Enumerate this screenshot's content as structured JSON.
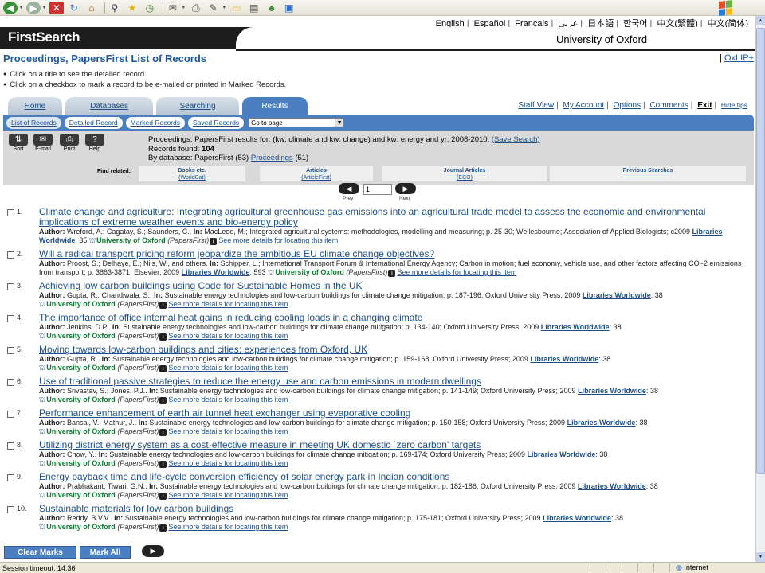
{
  "browser": {
    "toolbar_icons": [
      "back-icon",
      "forward-icon",
      "stop-icon",
      "refresh-icon",
      "home-icon",
      "search-icon",
      "favorites-icon",
      "history-icon",
      "mail-icon",
      "print-icon",
      "edit-icon",
      "folder-icon",
      "research-icon",
      "messenger-icon",
      "screenshot-icon"
    ],
    "status": "Session timeout: 14:36",
    "zone": "Internet"
  },
  "header": {
    "languages": [
      "English",
      "Español",
      "Français",
      "عربي",
      "日本語",
      "한국어",
      "中文(繁體)",
      "中文(简体)"
    ],
    "brand": "FirstSearch",
    "institution": "University of Oxford"
  },
  "page": {
    "title": "Proceedings, PapersFirst List of Records",
    "oxlip": "OxLIP+",
    "instructions": [
      "Click on a title to see the detailed record.",
      "Click on a checkbox to mark a record to be e-mailed or printed in Marked Records."
    ]
  },
  "tabs": [
    "Home",
    "Databases",
    "Searching",
    "Results"
  ],
  "util_links": [
    "Staff View",
    "My Account",
    "Options",
    "Comments",
    "Exit",
    "Hide tips"
  ],
  "subtabs": [
    "List of Records",
    "Detailed Record",
    "Marked Records",
    "Saved Records"
  ],
  "goto": "Go to page",
  "tools": [
    "Sort",
    "E-mail",
    "Print",
    "Help"
  ],
  "summary": {
    "line1": "Proceedings, PapersFirst results for: (kw: climate and kw: change) and kw: energy and yr: 2008-2010.",
    "save": "(Save Search)",
    "found_label": "Records found:",
    "found": "104",
    "bydb_label": "By database:",
    "bydb_papers": "PapersFirst (53)",
    "bydb_proc": "Proceedings",
    "bydb_proc_count": "(51)"
  },
  "find_related": {
    "label": "Find related:",
    "items": [
      {
        "title": "Books etc.",
        "sub": "(WorldCat)"
      },
      {
        "title": "Articles",
        "sub": "(ArticleFirst)"
      },
      {
        "title": "Journal Articles",
        "sub": "(ECO)"
      },
      {
        "title": "Previous Searches",
        "sub": ""
      }
    ]
  },
  "pager": {
    "prev": "Prev",
    "next": "Next",
    "page": "1"
  },
  "records": [
    {
      "num": "1.",
      "title": "Climate change and agriculture: Integrating agricultural greenhouse gas emissions into an agricultural trade model to assess the economic and environmental implications of extreme weather events and bio-energy policy",
      "author": "Wreford, A.; Cagatay, S.; Saunders, C.",
      "in": "MacLeod, M.; Integrated agricultural systems: methodologies, modelling and measuring; p. 25-30; Wellesbourne; Association of Applied Biologists; c2009",
      "lw_count": ": 35",
      "library": "University of Oxford",
      "db": "(PapersFirst)",
      "more": "See more details for locating this item"
    },
    {
      "num": "2.",
      "title": "Will a radical transport pricing reform jeopardize the ambitious EU climate change objectives?",
      "author": "Proost, S.; Delhaye, E.; Nijs, W., and others",
      "in": "Schipper, L.; International Transport Forum & International Energy Agency; Carbon in motion; fuel economy, vehicle use, and other factors affecting CO~2 emissions from transport; p. 3863-3871; Elsevier; 2009",
      "lw_count": ": 593",
      "library": "University of Oxford",
      "db": "(PapersFirst)",
      "more": "See more details for locating this item"
    },
    {
      "num": "3.",
      "title": "Achieving low carbon buildings using Code for Sustainable Homes in the UK",
      "author": "Gupta, R.; Chandiwala, S.",
      "in": "Sustainable energy technologies and low-carbon buildings for climate change mitigation; p. 187-196; Oxford University Press; 2009",
      "lw_count": ": 38",
      "library": "University of Oxford",
      "db": "(PapersFirst)",
      "more": "See more details for locating this item"
    },
    {
      "num": "4.",
      "title": "The importance of office internal heat gains in reducing cooling loads in a changing climate",
      "author": "Jenkins, D.P.",
      "in": "Sustainable energy technologies and low-carbon buildings for climate change mitigation; p. 134-140; Oxford University Press; 2009",
      "lw_count": ": 38",
      "library": "University of Oxford",
      "db": "(PapersFirst)",
      "more": "See more details for locating this item"
    },
    {
      "num": "5.",
      "title": "Moving towards low-carbon buildings and cities: experiences from Oxford, UK",
      "author": "Gupta, R.",
      "in": "Sustainable energy technologies and low-carbon buildings for climate change mitigation; p. 159-168; Oxford University Press; 2009",
      "lw_count": ": 38",
      "library": "University of Oxford",
      "db": "(PapersFirst)",
      "more": "See more details for locating this item"
    },
    {
      "num": "6.",
      "title": "Use of traditional passive strategies to reduce the energy use and carbon emissions in modern dwellings",
      "author": "Srivastav, S.; Jones, P.J.",
      "in": "Sustainable energy technologies and low-carbon buildings for climate change mitigation; p. 141-149; Oxford University Press; 2009",
      "lw_count": ": 38",
      "library": "University of Oxford",
      "db": "(PapersFirst)",
      "more": "See more details for locating this item"
    },
    {
      "num": "7.",
      "title": "Performance enhancement of earth air tunnel heat exchanger using evaporative cooling",
      "author": "Bansal, V.; Mathur, J.",
      "in": "Sustainable energy technologies and low-carbon buildings for climate change mitigation; p. 150-158; Oxford University Press; 2009",
      "lw_count": ": 38",
      "library": "University of Oxford",
      "db": "(PapersFirst)",
      "more": "See more details for locating this item"
    },
    {
      "num": "8.",
      "title": "Utilizing district energy system as a cost-effective measure in meeting UK domestic `zero carbon' targets",
      "author": "Chow, Y.",
      "in": "Sustainable energy technologies and low-carbon buildings for climate change mitigation; p. 169-174; Oxford University Press; 2009",
      "lw_count": ": 38",
      "library": "University of Oxford",
      "db": "(PapersFirst)",
      "more": "See more details for locating this item"
    },
    {
      "num": "9.",
      "title": "Energy payback time and life-cycle conversion efficiency of solar energy park in Indian conditions",
      "author": "Prabhakant; Tiwari, G.N.",
      "in": "Sustainable energy technologies and low-carbon buildings for climate change mitigation; p. 182-186; Oxford University Press; 2009",
      "lw_count": ": 38",
      "library": "University of Oxford",
      "db": "(PapersFirst)",
      "more": "See more details for locating this item"
    },
    {
      "num": "10.",
      "title": "Sustainable materials for low carbon buildings",
      "author": "Reddy, B.V.V.",
      "in": "Sustainable energy technologies and low-carbon buildings for climate change mitigation; p. 175-181; Oxford University Press; 2009",
      "lw_count": ": 38",
      "library": "University of Oxford",
      "db": "(PapersFirst)",
      "more": "See more details for locating this item"
    }
  ],
  "labels": {
    "author": "Author:",
    "in": "In:",
    "libraries_worldwide": "Libraries Worldwide"
  },
  "bottom": {
    "clear": "Clear Marks",
    "markall": "Mark All"
  },
  "colors": {
    "accent": "#4a7fc1",
    "link": "#1d4f86",
    "brand_bar": "#1d1d1d",
    "library_green": "#0a7d2f"
  }
}
